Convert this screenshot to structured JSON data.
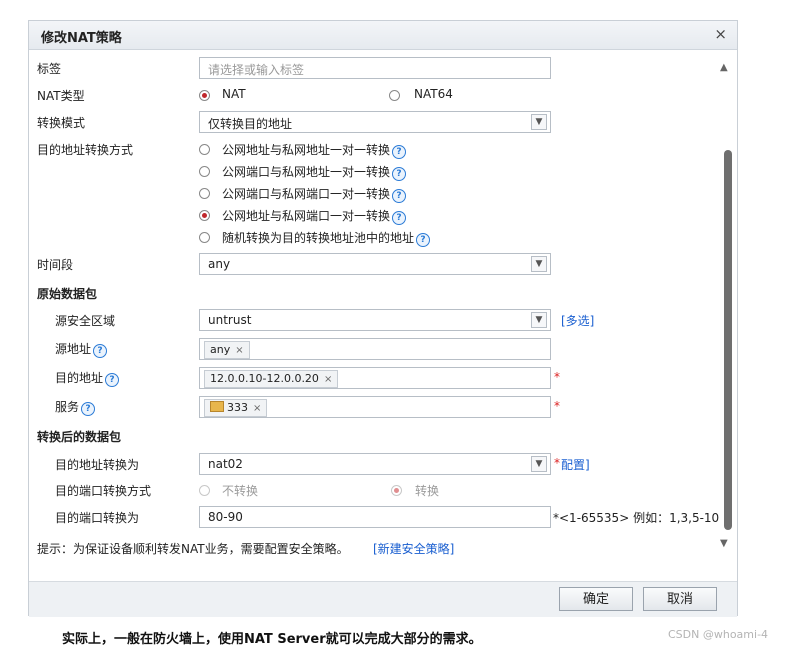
{
  "dialog": {
    "title": "修改NAT策略",
    "close": "×"
  },
  "form": {
    "tag": {
      "label": "标签",
      "placeholder": "请选择或输入标签"
    },
    "nat_type": {
      "label": "NAT类型",
      "options": [
        "NAT",
        "NAT64"
      ],
      "selected": "NAT"
    },
    "mode": {
      "label": "转换模式",
      "value": "仅转换目的地址"
    },
    "dst_method": {
      "label": "目的地址转换方式",
      "options": [
        "公网地址与私网地址一对一转换",
        "公网端口与私网地址一对一转换",
        "公网端口与私网端口一对一转换",
        "公网地址与私网端口一对一转换",
        "随机转换为目的转换地址池中的地址"
      ],
      "selected": "公网地址与私网端口一对一转换"
    },
    "time": {
      "label": "时间段",
      "value": "any"
    }
  },
  "original": {
    "heading": "原始数据包",
    "src_zone": {
      "label": "源安全区域",
      "value": "untrust",
      "link": "[多选]"
    },
    "src_addr": {
      "label": "源地址",
      "tags": [
        "any"
      ]
    },
    "dst_addr": {
      "label": "目的地址",
      "tags": [
        "12.0.0.10-12.0.0.20"
      ],
      "required": "*"
    },
    "service": {
      "label": "服务",
      "tags": [
        "333"
      ],
      "required": "*"
    }
  },
  "translated": {
    "heading": "转换后的数据包",
    "dst_to": {
      "label": "目的地址转换为",
      "value": "nat02",
      "required": "*",
      "link": "配置]"
    },
    "port_method": {
      "label": "目的端口转换方式",
      "options": [
        "不转换",
        "转换"
      ],
      "selected": "转换"
    },
    "port_to": {
      "label": "目的端口转换为",
      "value": "80-90",
      "hint": "*<1-65535> 例如：1,3,5-10"
    }
  },
  "notice": {
    "text": "提示：为保证设备顺利转发NAT业务，需要配置安全策略。",
    "link": "[新建安全策略]"
  },
  "buttons": {
    "ok": "确定",
    "cancel": "取消"
  },
  "caption": "实际上，一般在防火墙上，使用NAT Server就可以完成大部分的需求。",
  "watermark": "CSDN @whoami-4",
  "icons": {
    "help": "?",
    "scroll_up": "▲",
    "scroll_down": "▼",
    "dropdown": "chevron-down-icon",
    "remove": "×"
  },
  "colors": {
    "radio_selected": "#c0282d",
    "link": "#1a5fd0",
    "required": "#dd2222"
  }
}
